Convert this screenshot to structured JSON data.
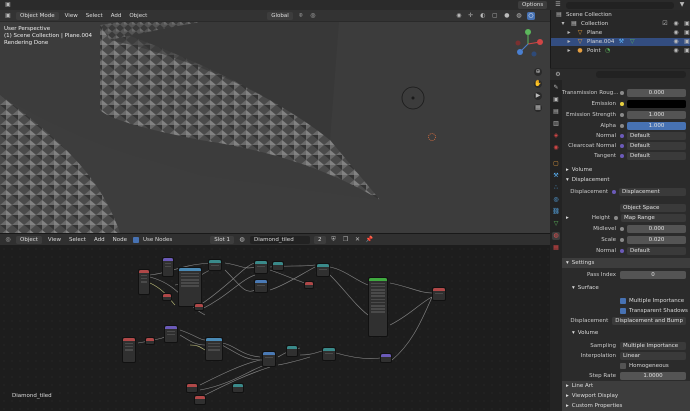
{
  "viewport": {
    "mode": "Object Mode",
    "menus": [
      "View",
      "Select",
      "Add",
      "Object"
    ],
    "orientation": "Global",
    "options": "Options",
    "overlay_line1": "User Perspective",
    "overlay_line2": "(1) Scene Collection | Plane.004",
    "overlay_line3": "Rendering Done"
  },
  "node_editor": {
    "type": "Object",
    "menus": [
      "View",
      "Select",
      "Add",
      "Node"
    ],
    "use_nodes": "Use Nodes",
    "slot": "Slot 1",
    "material": "Diamond_tiled",
    "users": "2",
    "footer_name": "Diamond_tiled"
  },
  "outliner": {
    "root": "Scene Collection",
    "items": [
      "Collection",
      "Plane",
      "Plane.004",
      "Point"
    ]
  },
  "properties": {
    "rows": [
      {
        "label": "Transmission Roug...",
        "value": "0.000"
      },
      {
        "label": "Emission",
        "value": ""
      },
      {
        "label": "Emission Strength",
        "value": "1.000"
      },
      {
        "label": "Alpha",
        "value": "1.000"
      },
      {
        "label": "Normal",
        "value": "Default"
      },
      {
        "label": "Clearcoat Normal",
        "value": "Default"
      },
      {
        "label": "Tangent",
        "value": "Default"
      }
    ],
    "volume_header": "Volume",
    "displacement_header": "Displacement",
    "displacement_value": "Displacement",
    "object_space": "Object Space",
    "height_label": "Height",
    "height_value": "Map Range",
    "midlevel_label": "Midlevel",
    "midlevel_value": "0.000",
    "scale_label": "Scale",
    "scale_value": "0.020",
    "normal_label": "Normal",
    "normal_value": "Default",
    "settings_header": "Settings",
    "pass_index_label": "Pass Index",
    "pass_index_value": "0",
    "surface_header": "Surface",
    "multiple_importance": "Multiple Importance",
    "transparent_shadows": "Transparent Shadows",
    "displacement_method_label": "Displacement",
    "displacement_method_value": "Displacement and Bump",
    "volume_sub_header": "Volume",
    "sampling_label": "Sampling",
    "sampling_value": "Multiple Importance",
    "interpolation_label": "Interpolation",
    "interpolation_value": "Linear",
    "homogeneous": "Homogeneous",
    "step_rate_label": "Step Rate",
    "step_rate_value": "1.0000",
    "line_art": "Line Art",
    "viewport_display": "Viewport Display",
    "custom_properties": "Custom Properties"
  },
  "colors": {
    "accent": "#4772b3",
    "alpha_field": "#4772b3"
  }
}
